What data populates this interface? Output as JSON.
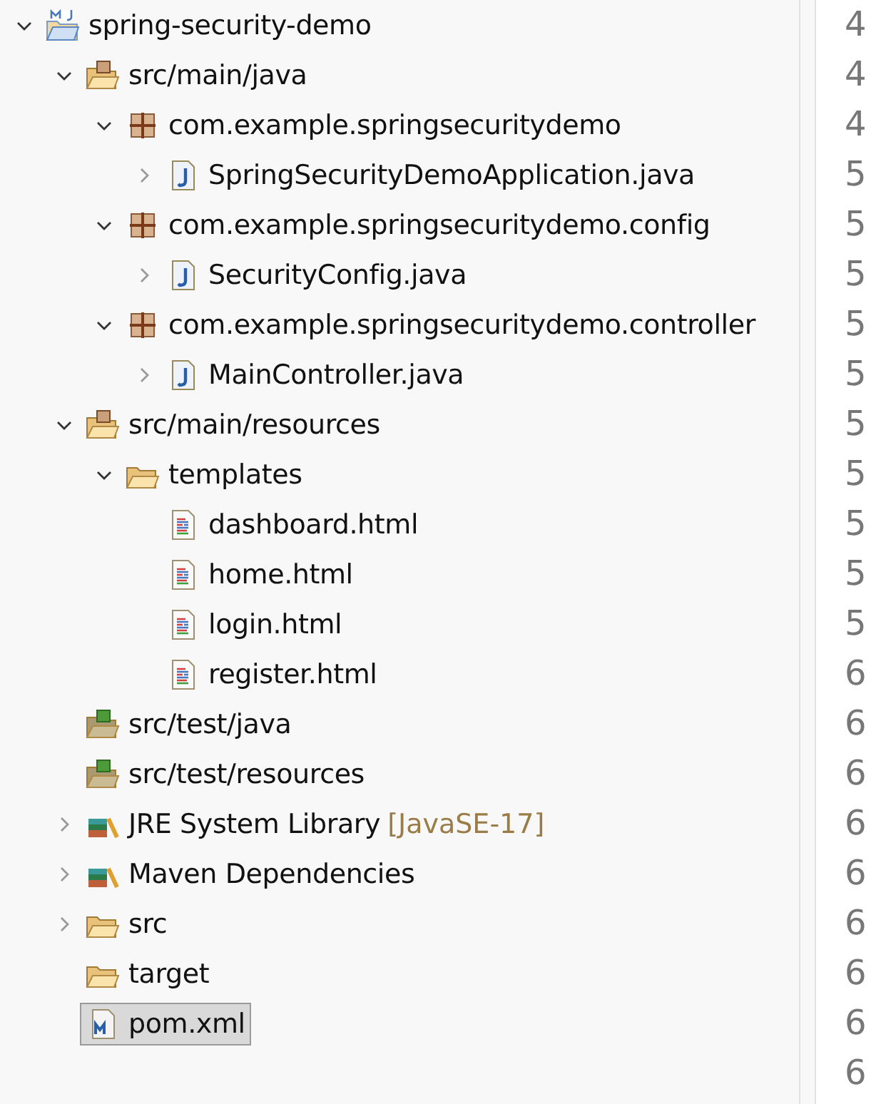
{
  "tree": [
    {
      "label": "spring-security-demo",
      "kind": "project",
      "expanded": true,
      "selected": false,
      "children": [
        {
          "label": "src/main/java",
          "kind": "source-folder",
          "expanded": true,
          "selected": false,
          "children": [
            {
              "label": "com.example.springsecuritydemo",
              "kind": "package",
              "expanded": true,
              "selected": false,
              "children": [
                {
                  "label": "SpringSecurityDemoApplication.java",
                  "kind": "java-file",
                  "expanded": false,
                  "selected": false
                }
              ]
            },
            {
              "label": "com.example.springsecuritydemo.config",
              "kind": "package",
              "expanded": true,
              "selected": false,
              "children": [
                {
                  "label": "SecurityConfig.java",
                  "kind": "java-file",
                  "expanded": false,
                  "selected": false
                }
              ]
            },
            {
              "label": "com.example.springsecuritydemo.controller",
              "kind": "package",
              "expanded": true,
              "selected": false,
              "children": [
                {
                  "label": "MainController.java",
                  "kind": "java-file",
                  "expanded": false,
                  "selected": false
                }
              ]
            }
          ]
        },
        {
          "label": "src/main/resources",
          "kind": "source-folder",
          "expanded": true,
          "selected": false,
          "children": [
            {
              "label": "templates",
              "kind": "folder",
              "expanded": true,
              "selected": false,
              "children": [
                {
                  "label": "dashboard.html",
                  "kind": "html-file",
                  "selected": false
                },
                {
                  "label": "home.html",
                  "kind": "html-file",
                  "selected": false
                },
                {
                  "label": "login.html",
                  "kind": "html-file",
                  "selected": false
                },
                {
                  "label": "register.html",
                  "kind": "html-file",
                  "selected": false
                }
              ]
            }
          ]
        },
        {
          "label": "src/test/java",
          "kind": "test-folder",
          "selected": false
        },
        {
          "label": "src/test/resources",
          "kind": "test-folder",
          "selected": false
        },
        {
          "label": "JRE System Library",
          "decoration": "[JavaSE-17]",
          "kind": "library",
          "expanded": false,
          "selected": false
        },
        {
          "label": "Maven Dependencies",
          "kind": "library",
          "expanded": false,
          "selected": false
        },
        {
          "label": "src",
          "kind": "folder",
          "expanded": false,
          "selected": false
        },
        {
          "label": "target",
          "kind": "folder",
          "selected": false
        },
        {
          "label": "pom.xml",
          "kind": "xml-file",
          "selected": true
        }
      ]
    }
  ],
  "editor_line_numbers": [
    "4",
    "4",
    "4",
    "5",
    "5",
    "5",
    "5",
    "5",
    "5",
    "5",
    "5",
    "5",
    "5",
    "6",
    "6",
    "6",
    "6",
    "6",
    "6",
    "6",
    "6",
    "6"
  ]
}
